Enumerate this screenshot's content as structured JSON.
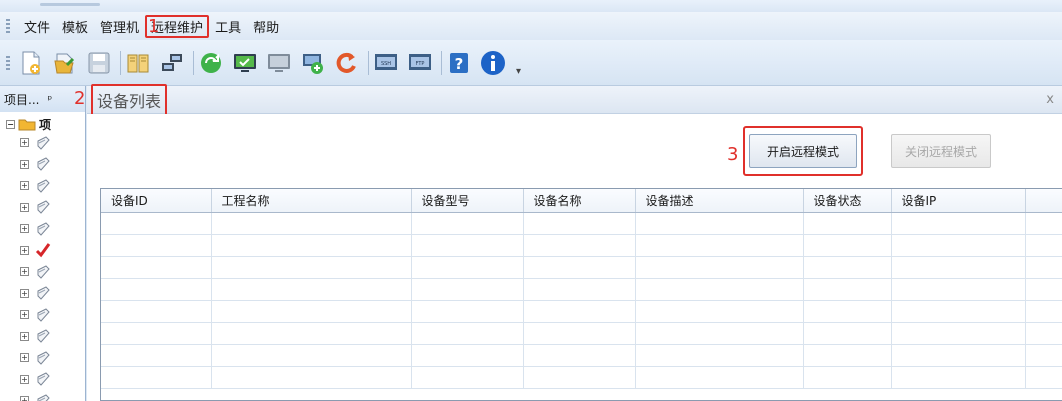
{
  "menubar": {
    "items": [
      {
        "label": "文件"
      },
      {
        "label": "模板"
      },
      {
        "label": "管理机"
      },
      {
        "label": "远程维护",
        "highlighted": true
      },
      {
        "label": "工具"
      },
      {
        "label": "帮助"
      }
    ]
  },
  "annotations": {
    "step1": "1",
    "step2": "2",
    "step3": "3"
  },
  "toolbar": {
    "icons": [
      "new-file-icon",
      "open-file-icon",
      "save-icon",
      "book-icon",
      "network-icon",
      "refresh-green-icon",
      "monitor-check-icon",
      "monitor-gray-icon",
      "add-connection-icon",
      "reload-icon",
      "ssh-icon",
      "ftp-icon",
      "help-icon",
      "info-icon"
    ],
    "ssh_label": "SSH",
    "ftp_label": "FTP"
  },
  "sidepanel": {
    "title": "项目...",
    "pin": "ᵖ",
    "root_label": "项",
    "node_count": 13
  },
  "document": {
    "tab_title": "设备列表",
    "close": "x",
    "open_button": "开启远程模式",
    "close_button": "关闭远程模式"
  },
  "table": {
    "columns": [
      "设备ID",
      "工程名称",
      "设备型号",
      "设备名称",
      "设备描述",
      "设备状态",
      "设备IP"
    ],
    "rows": []
  },
  "colors": {
    "highlight": "#e0302b",
    "menubar": "#dde8f5"
  }
}
